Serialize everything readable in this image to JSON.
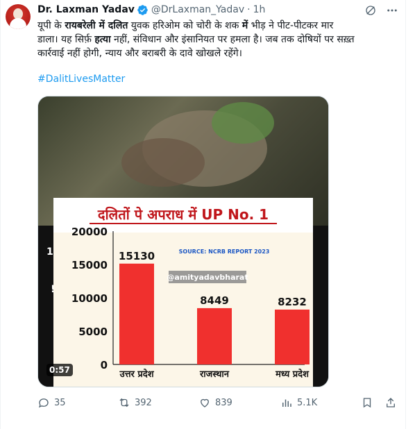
{
  "author": {
    "name": "Dr. Laxman Yadav",
    "handle": "@DrLaxman_Yadav",
    "separator": "·",
    "time": "1h"
  },
  "tweet": {
    "line1_a": "यूपी के ",
    "line1_b": "रायबरेली में दलित",
    "line1_c": " युवक हरिओम को चोरी के शक ",
    "line1_d": "में",
    "line1_e": " भीड़ ने पीट-पीटकर मार",
    "line2_a": "डाला। यह सिर्फ़ ",
    "line2_b": "हत्या",
    "line2_c": " नहीं, संविधान और इंसानियत पर हमला है। जब तक दोषियों पर सख़्त",
    "line3": "कार्रवाई नहीं होगी, न्याय और बराबरी के दावे खोखले रहेंगे।",
    "hashtag": "#DalitLivesMatter"
  },
  "media": {
    "duration": "0:57",
    "partial_1": "1(",
    "partial_2": "!"
  },
  "chart_data": {
    "type": "bar",
    "title": "दलितों पे अपराध में UP No. 1",
    "source": "SOURCE: NCRB REPORT 2023",
    "watermark": "@amityadavbharat",
    "categories": [
      "उत्तर प्रदेश",
      "राजस्थान",
      "मध्य प्रदेश"
    ],
    "values": [
      15130,
      8449,
      8232
    ],
    "value_labels": [
      "15130",
      "8449",
      "8232"
    ],
    "ylim": [
      0,
      20000
    ],
    "yticks": [
      "0",
      "5000",
      "10000",
      "15000",
      "20000"
    ],
    "bar_color": "#f0302e",
    "grid": false,
    "xlabel": "",
    "ylabel": ""
  },
  "actions": {
    "replies": "35",
    "reposts": "392",
    "likes": "839",
    "views": "5.1K"
  },
  "colors": {
    "accent": "#1d9bf0",
    "muted": "#536471"
  }
}
